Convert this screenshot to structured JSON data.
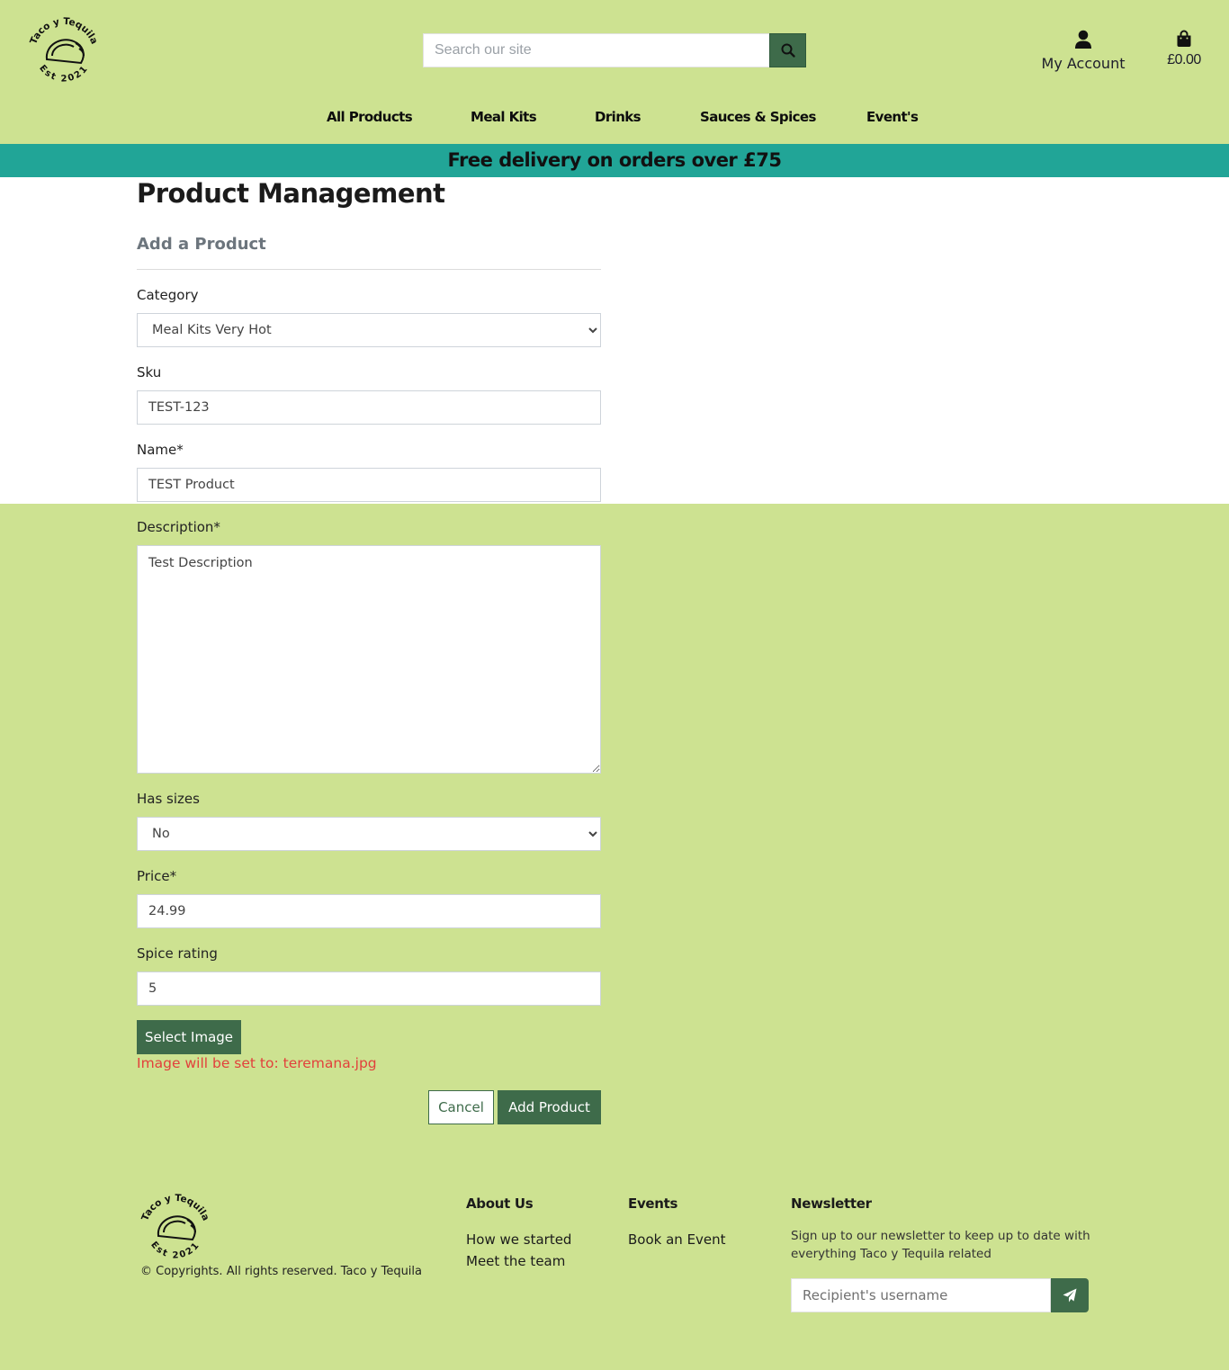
{
  "brand": {
    "logo_top_text": "Taco y Tequila",
    "logo_bottom_text": "Est 2021"
  },
  "header": {
    "search_placeholder": "Search our site",
    "account_label": "My Account",
    "bag_total": "£0.00",
    "icons": {
      "search": "search-icon",
      "account": "user-icon",
      "bag": "shopping-bag-icon"
    }
  },
  "nav": {
    "items": [
      "All Products",
      "Meal Kits",
      "Drinks",
      "Sauces & Spices",
      "Event's"
    ]
  },
  "banner": {
    "text": "Free delivery on orders over £75"
  },
  "main": {
    "title": "Product Management",
    "subtitle": "Add a Product",
    "form": {
      "category_label": "Category",
      "category_value": "Meal Kits Very Hot",
      "sku_label": "Sku",
      "sku_value": "TEST-123",
      "name_label": "Name*",
      "name_value": "TEST Product",
      "description_label": "Description*",
      "description_value": "Test Description",
      "has_sizes_label": "Has sizes",
      "has_sizes_value": "No",
      "price_label": "Price*",
      "price_value": "24.99",
      "spice_label": "Spice rating",
      "spice_value": "5",
      "select_image_label": "Select Image",
      "image_note": "Image will be set to: teremana.jpg",
      "cancel_label": "Cancel",
      "submit_label": "Add Product"
    }
  },
  "footer": {
    "copyright": "© Copyrights. All rights reserved. Taco y Tequila",
    "about_heading": "About Us",
    "about_links": [
      "How we started",
      "Meet the team"
    ],
    "events_heading": "Events",
    "events_links": [
      "Book an Event"
    ],
    "newsletter_heading": "Newsletter",
    "newsletter_text": "Sign up to our newsletter to keep up to date with everything Taco y Tequila related",
    "newsletter_placeholder": "Recipient's username",
    "newsletter_icon": "paper-plane-icon"
  },
  "colors": {
    "page_bg": "#cde291",
    "banner_bg": "#21a597",
    "primary_button": "#3e6b4a",
    "error_text": "#e2403c"
  }
}
